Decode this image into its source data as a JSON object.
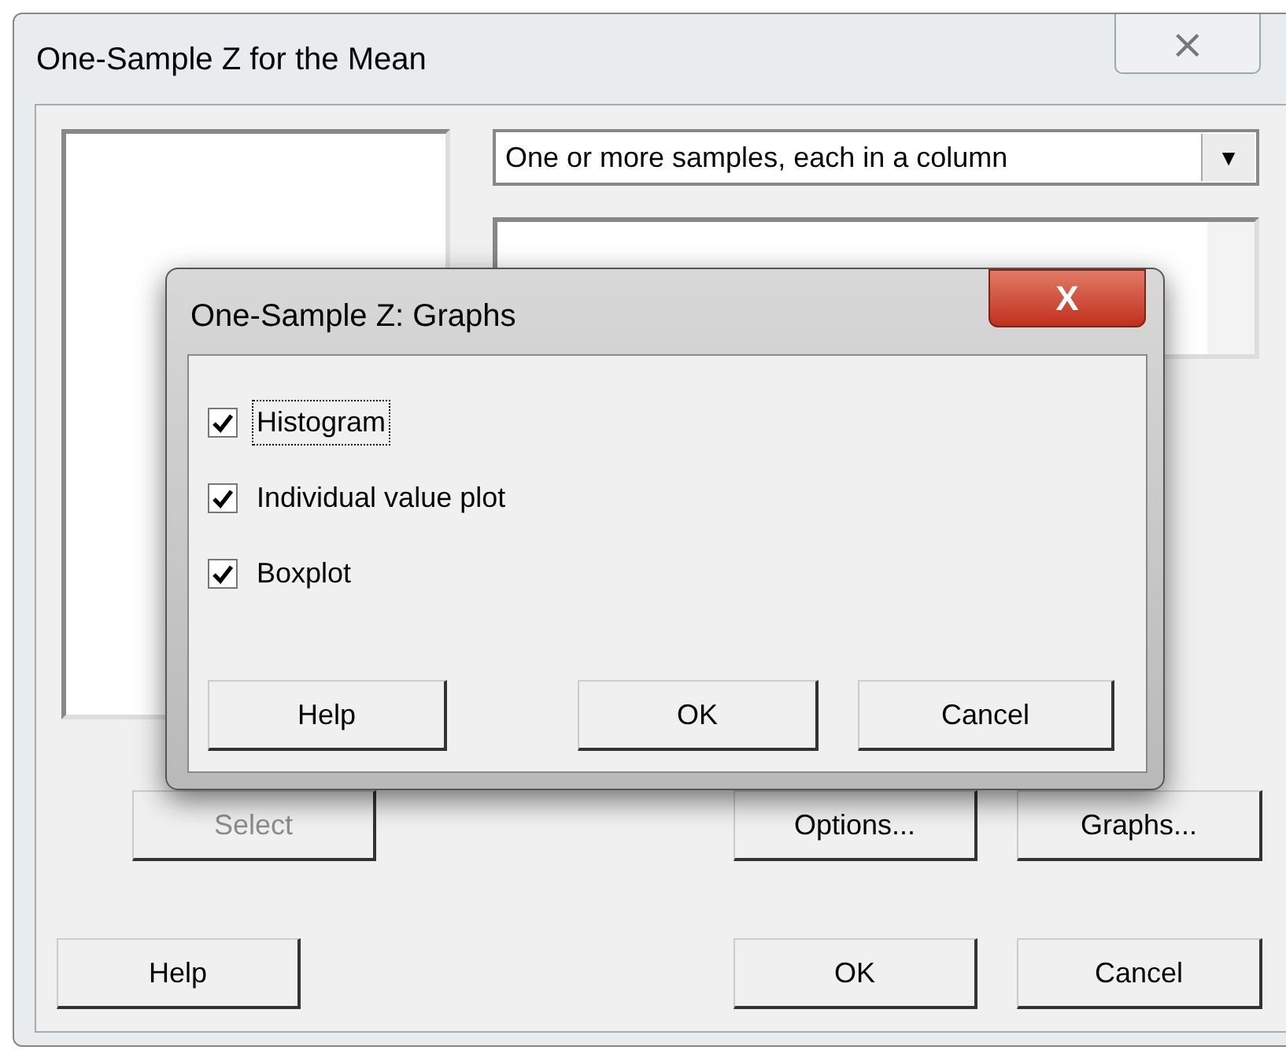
{
  "window": {
    "title": "One-Sample Z for the Mean",
    "close": "⨯"
  },
  "mode_select": {
    "value": "One or more samples, each in a column",
    "arrow": "▼"
  },
  "side_buttons": [
    {
      "label": "Select",
      "disabled": true
    },
    {
      "label": "Options...",
      "disabled": false
    },
    {
      "label": "Graphs...",
      "disabled": false
    }
  ],
  "buttons": [
    {
      "label": "Help"
    },
    {
      "label": "OK"
    },
    {
      "label": "Cancel"
    }
  ],
  "dialog": {
    "title": "One-Sample Z: Graphs",
    "close": "X",
    "options": [
      {
        "label": "Histogram",
        "checked": true,
        "focused": true
      },
      {
        "label": "Individual value plot",
        "checked": true,
        "focused": false
      },
      {
        "label": "Boxplot",
        "checked": true,
        "focused": false
      }
    ],
    "buttons": [
      {
        "label": "Help"
      },
      {
        "label": "OK"
      },
      {
        "label": "Cancel"
      }
    ]
  }
}
